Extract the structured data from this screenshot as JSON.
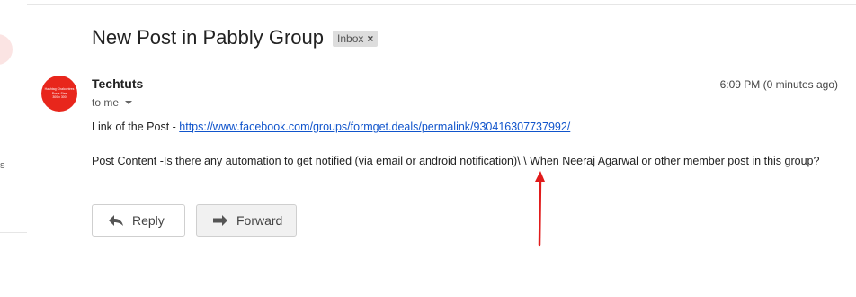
{
  "email": {
    "subject": "New Post in Pabbly Group",
    "label": "Inbox",
    "label_close_icon": "×",
    "sender": "Techtuts",
    "recipient": "to me",
    "timestamp": "6:09 PM (0 minutes ago)",
    "avatar_text": [
      "Hashtag Chalcontres",
      "Posts Size",
      "300 x 300"
    ],
    "body": {
      "link_prefix": "Link of the Post - ",
      "link_text": "https://www.facebook.com/groups/formget.deals/permalink/930416307737992/",
      "content": "Post Content -Is there any automation to get notified (via email or android notification)\\ \\ When Neeraj Agarwal or other member post in this group?"
    }
  },
  "actions": {
    "reply_label": "Reply",
    "forward_label": "Forward"
  },
  "icons": {
    "reply": "reply-icon",
    "forward": "forward-icon",
    "caret": "chevron-down-icon"
  },
  "colors": {
    "avatar": "#e8261c",
    "link": "#1155cc",
    "annotation": "#e11b1b"
  }
}
